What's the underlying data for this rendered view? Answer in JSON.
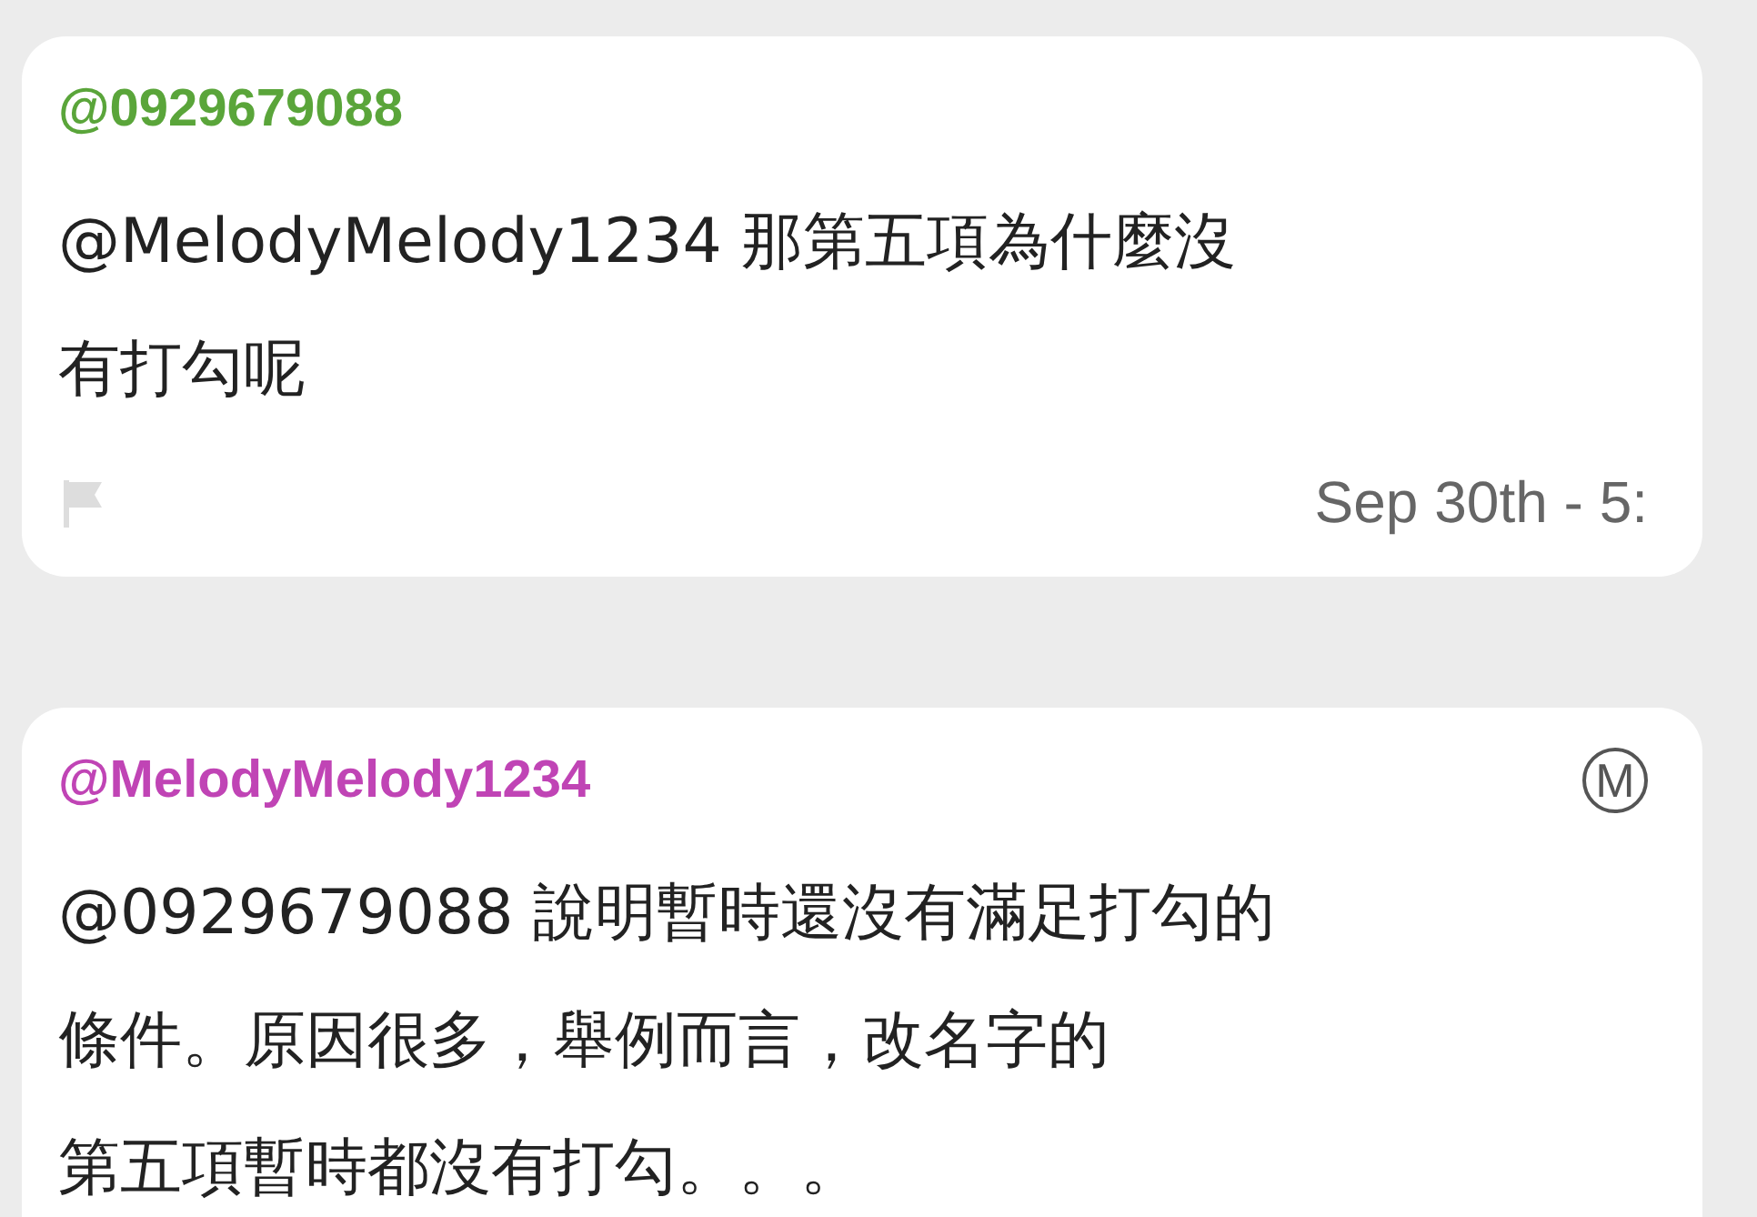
{
  "messages": [
    {
      "author": "@0929679088",
      "color": "#5aa53a",
      "lines": [
        "@MelodyMelody1234 那第五項為什麼沒",
        "有打勾呢"
      ],
      "flagged": false,
      "time": "Sep 30th - 5:"
    },
    {
      "author": "@MelodyMelody1234",
      "color": "#c044b5",
      "badge": "M",
      "lines": [
        "@0929679088 說明暫時還沒有滿足打勾的",
        "條件。原因很多，舉例而言，改名字的",
        "第五項暫時都沒有打勾。。。"
      ]
    }
  ]
}
